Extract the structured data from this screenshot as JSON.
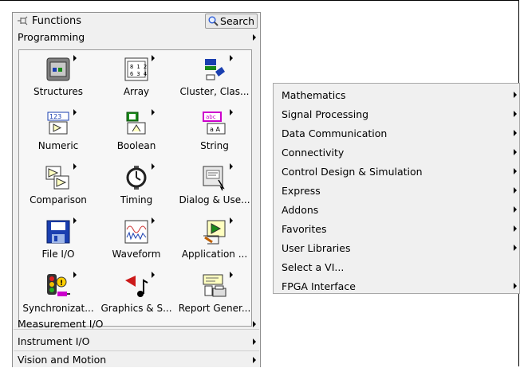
{
  "palette": {
    "title": "Functions",
    "search_label": "Search",
    "category": "Programming",
    "icons": [
      {
        "label": "Structures",
        "icon": "structures-icon"
      },
      {
        "label": "Array",
        "icon": "array-icon"
      },
      {
        "label": "Cluster, Clas...",
        "icon": "cluster-icon"
      },
      {
        "label": "Numeric",
        "icon": "numeric-icon"
      },
      {
        "label": "Boolean",
        "icon": "boolean-icon"
      },
      {
        "label": "String",
        "icon": "string-icon"
      },
      {
        "label": "Comparison",
        "icon": "comparison-icon"
      },
      {
        "label": "Timing",
        "icon": "timing-icon"
      },
      {
        "label": "Dialog & Use...",
        "icon": "dialog-icon"
      },
      {
        "label": "File I/O",
        "icon": "file-io-icon"
      },
      {
        "label": "Waveform",
        "icon": "waveform-icon"
      },
      {
        "label": "Application ...",
        "icon": "application-icon"
      },
      {
        "label": "Synchronizat...",
        "icon": "synchronization-icon"
      },
      {
        "label": "Graphics & S...",
        "icon": "graphics-sound-icon"
      },
      {
        "label": "Report Gener...",
        "icon": "report-generation-icon"
      }
    ],
    "bottom_categories": [
      "Measurement I/O",
      "Instrument I/O",
      "Vision and Motion"
    ]
  },
  "submenu": {
    "items": [
      {
        "label": "Mathematics",
        "has_submenu": true
      },
      {
        "label": "Signal Processing",
        "has_submenu": true
      },
      {
        "label": "Data Communication",
        "has_submenu": true
      },
      {
        "label": "Connectivity",
        "has_submenu": true
      },
      {
        "label": "Control Design & Simulation",
        "has_submenu": true
      },
      {
        "label": "Express",
        "has_submenu": true
      },
      {
        "label": "Addons",
        "has_submenu": true
      },
      {
        "label": "Favorites",
        "has_submenu": true
      },
      {
        "label": "User Libraries",
        "has_submenu": true
      },
      {
        "label": "Select a VI...",
        "has_submenu": false
      },
      {
        "label": "FPGA Interface",
        "has_submenu": true
      }
    ]
  },
  "colors": {
    "palette_bg": "#f0f0f0",
    "icon_area_bg": "#f7f7f7",
    "accent_blue": "#1a3fb0",
    "accent_magenta": "#cc00cc",
    "accent_green": "#1a8a1a"
  }
}
